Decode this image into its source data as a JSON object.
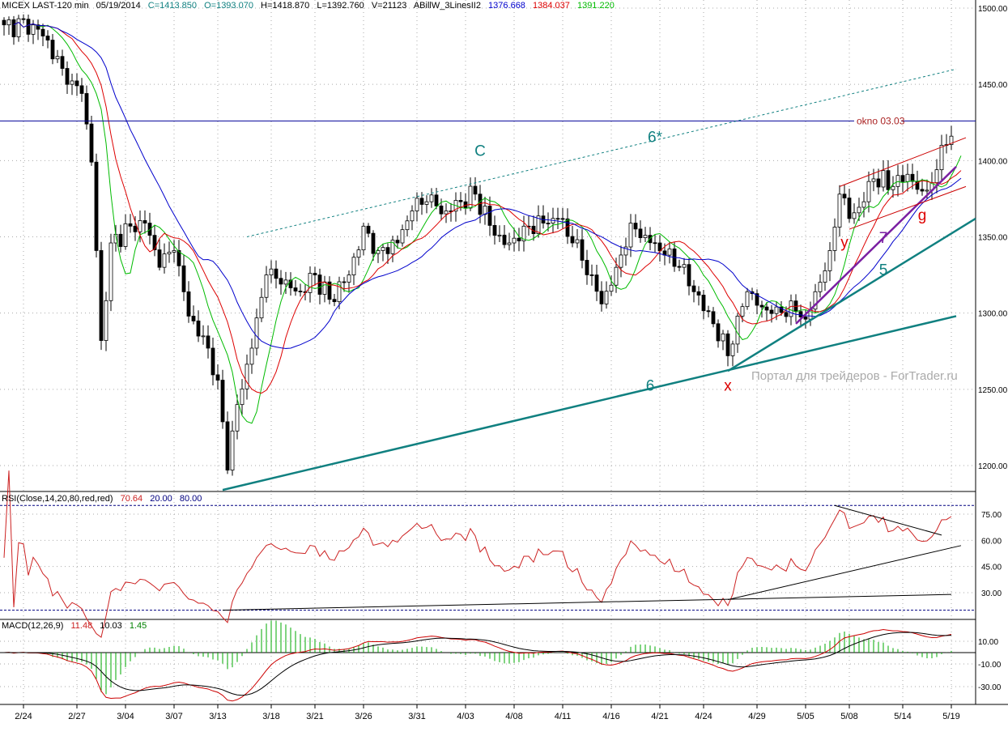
{
  "header": {
    "symbol": "MICEX LAST-120 min",
    "date": "05/19/2014",
    "close": "C=1413.850",
    "open": "O=1393.070",
    "high": "H=1418.870",
    "low": "L=1392.760",
    "volume": "V=21123",
    "indicator": "ABillW_3LinesII2",
    "ma_values": [
      "1376.668",
      "1384.037",
      "1391.220"
    ]
  },
  "rsi_header": {
    "label": "RSI(Close,14,20,80,red,red)",
    "value": "70.64",
    "low": "20.00",
    "high": "80.00"
  },
  "macd_header": {
    "label": "MACD(12,26,9)",
    "macd": "11.48",
    "signal": "10.03",
    "hist": "1.45"
  },
  "watermark": "Портал для трейдеров - ForTrader.ru",
  "colors": {
    "ma_fast": "#00bb00",
    "ma_mid": "#dd0000",
    "ma_slow": "#0000cc",
    "trend": "#108080",
    "wave": "#7a1fa2",
    "channel": "#cc0000",
    "rsi": "#cc2222"
  },
  "chart_data": {
    "type": "candlestick",
    "title": "MICEX LAST-120 min",
    "x_unit": "bar index",
    "x_ticks": [
      {
        "bar": 4,
        "label": "2/24"
      },
      {
        "bar": 15,
        "label": "2/27"
      },
      {
        "bar": 25,
        "label": "3/04"
      },
      {
        "bar": 35,
        "label": "3/07"
      },
      {
        "bar": 44,
        "label": "3/13"
      },
      {
        "bar": 55,
        "label": "3/18"
      },
      {
        "bar": 64,
        "label": "3/21"
      },
      {
        "bar": 74,
        "label": "3/26"
      },
      {
        "bar": 85,
        "label": "3/31"
      },
      {
        "bar": 95,
        "label": "4/03"
      },
      {
        "bar": 105,
        "label": "4/08"
      },
      {
        "bar": 115,
        "label": "4/11"
      },
      {
        "bar": 125,
        "label": "4/16"
      },
      {
        "bar": 135,
        "label": "4/21"
      },
      {
        "bar": 144,
        "label": "4/24"
      },
      {
        "bar": 155,
        "label": "4/29"
      },
      {
        "bar": 165,
        "label": "5/05"
      },
      {
        "bar": 174,
        "label": "5/08"
      },
      {
        "bar": 185,
        "label": "5/14"
      },
      {
        "bar": 195,
        "label": "5/19"
      }
    ],
    "price_ticks": [
      "1500.00",
      "1450.00",
      "1400.00",
      "1350.00",
      "1300.00",
      "1250.00",
      "1200.00"
    ],
    "price_range": [
      1178,
      1505
    ],
    "close_keypoints": [
      [
        0,
        1489
      ],
      [
        6,
        1489
      ],
      [
        9,
        1479
      ],
      [
        13,
        1450
      ],
      [
        16,
        1444
      ],
      [
        18,
        1399
      ],
      [
        20,
        1282
      ],
      [
        22,
        1346
      ],
      [
        26,
        1357
      ],
      [
        29,
        1359
      ],
      [
        32,
        1330
      ],
      [
        35,
        1341
      ],
      [
        38,
        1298
      ],
      [
        42,
        1277
      ],
      [
        44,
        1256
      ],
      [
        46,
        1197
      ],
      [
        48,
        1240
      ],
      [
        51,
        1277
      ],
      [
        54,
        1325
      ],
      [
        57,
        1319
      ],
      [
        61,
        1314
      ],
      [
        64,
        1325
      ],
      [
        67,
        1309
      ],
      [
        71,
        1325
      ],
      [
        74,
        1357
      ],
      [
        77,
        1341
      ],
      [
        81,
        1346
      ],
      [
        84,
        1367
      ],
      [
        87,
        1373
      ],
      [
        91,
        1367
      ],
      [
        94,
        1373
      ],
      [
        97,
        1378
      ],
      [
        101,
        1351
      ],
      [
        104,
        1346
      ],
      [
        107,
        1357
      ],
      [
        111,
        1359
      ],
      [
        114,
        1362
      ],
      [
        117,
        1346
      ],
      [
        121,
        1325
      ],
      [
        123,
        1306
      ],
      [
        126,
        1330
      ],
      [
        129,
        1359
      ],
      [
        132,
        1351
      ],
      [
        136,
        1338
      ],
      [
        139,
        1330
      ],
      [
        142,
        1314
      ],
      [
        146,
        1293
      ],
      [
        149,
        1272
      ],
      [
        151,
        1298
      ],
      [
        153,
        1314
      ],
      [
        156,
        1304
      ],
      [
        159,
        1304
      ],
      [
        163,
        1301
      ],
      [
        165,
        1296
      ],
      [
        167,
        1314
      ],
      [
        170,
        1341
      ],
      [
        172,
        1378
      ],
      [
        174,
        1362
      ],
      [
        177,
        1373
      ],
      [
        179,
        1388
      ],
      [
        183,
        1383
      ],
      [
        186,
        1391
      ],
      [
        189,
        1380
      ],
      [
        192,
        1394
      ],
      [
        193,
        1410
      ],
      [
        195,
        1416
      ]
    ],
    "ma_periods": [
      5,
      10,
      20
    ],
    "horizontal_lines": [
      {
        "price": 1426,
        "label": "okno 03.03"
      }
    ],
    "trendlines": [
      {
        "name": "line-6",
        "from": [
          45,
          1184
        ],
        "to": [
          196,
          1298
        ],
        "style": "trend"
      },
      {
        "name": "line-5",
        "from": [
          149,
          1262
        ],
        "to": [
          200,
          1362
        ],
        "style": "trend"
      },
      {
        "name": "line-6star",
        "from": [
          50,
          1350
        ],
        "to": [
          196,
          1460
        ],
        "style": "dotted"
      },
      {
        "name": "line-7",
        "from": [
          163,
          1293
        ],
        "to": [
          196,
          1396
        ],
        "style": "wave"
      },
      {
        "name": "channel-upper",
        "from": [
          172,
          1383
        ],
        "to": [
          198,
          1415
        ],
        "style": "channel"
      },
      {
        "name": "channel-lower",
        "from": [
          174,
          1355
        ],
        "to": [
          198,
          1383
        ],
        "style": "channel"
      }
    ],
    "annotations": [
      {
        "text": "C",
        "at": [
          98,
          1403
        ],
        "color": "#108080"
      },
      {
        "text": "6*",
        "at": [
          134,
          1412
        ],
        "color": "#108080"
      },
      {
        "text": "6",
        "at": [
          133,
          1249
        ],
        "color": "#108080"
      },
      {
        "text": "x",
        "at": [
          149,
          1249
        ],
        "color": "#dd0000"
      },
      {
        "text": "y",
        "at": [
          173,
          1343
        ],
        "color": "#dd0000"
      },
      {
        "text": "7",
        "at": [
          181,
          1346
        ],
        "color": "#7a1fa2"
      },
      {
        "text": "5",
        "at": [
          181,
          1325
        ],
        "color": "#108080"
      },
      {
        "text": "g",
        "at": [
          189,
          1361
        ],
        "color": "#dd0000"
      }
    ],
    "rsi": {
      "period": 14,
      "levels": [
        20,
        80
      ],
      "ticks": [
        "75.00",
        "60.00",
        "45.00",
        "30.00"
      ],
      "trendlines": [
        {
          "from": [
            45,
            20
          ],
          "to": [
            195,
            29
          ]
        },
        {
          "from": [
            149,
            26
          ],
          "to": [
            197,
            57
          ]
        },
        {
          "from": [
            171,
            80
          ],
          "to": [
            193,
            63
          ]
        }
      ]
    },
    "macd": {
      "fast": 12,
      "slow": 26,
      "signal": 9,
      "ticks": [
        "10.00",
        "-10.00",
        "-30.00"
      ]
    }
  }
}
